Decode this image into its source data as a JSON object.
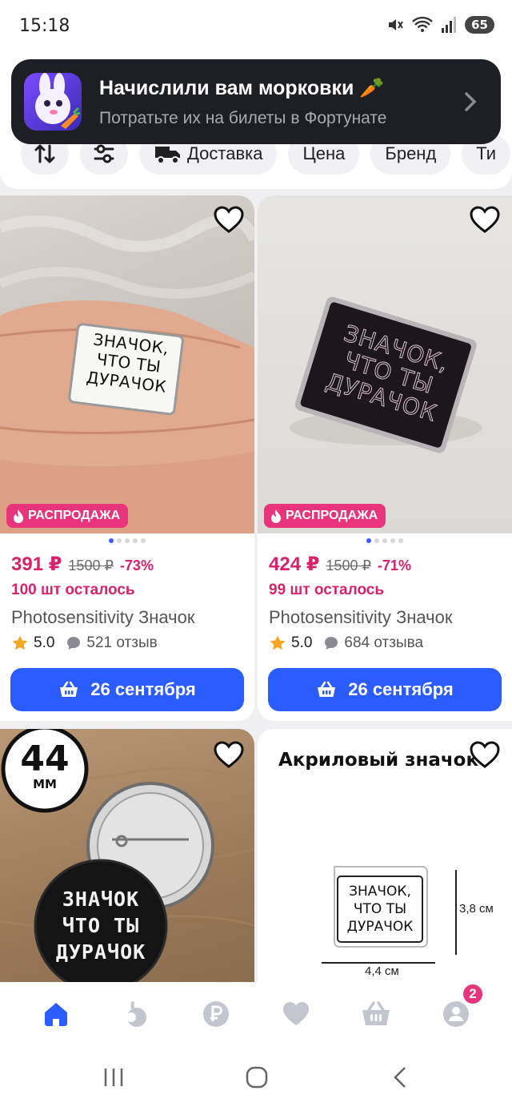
{
  "status_bar": {
    "time": "15:18",
    "battery": "65",
    "icons": [
      "mute-icon",
      "wifi-icon",
      "signal-icon",
      "battery-icon"
    ]
  },
  "toast": {
    "title": "Начислили вам морковки 🥕",
    "subtitle": "Потратьте их на билеты в Фортунате"
  },
  "filters": {
    "chips": [
      {
        "icon": "sort-icon",
        "label": ""
      },
      {
        "icon": "filter-sliders-icon",
        "label": ""
      },
      {
        "icon": "delivery-truck-icon",
        "label": "Доставка"
      },
      {
        "icon": "",
        "label": "Цена"
      },
      {
        "icon": "",
        "label": "Бренд"
      },
      {
        "icon": "",
        "label": "Ти"
      }
    ]
  },
  "products": [
    {
      "badge": "РАСПРОДАЖА",
      "price": "391 ₽",
      "old_price": "1500 ₽",
      "discount": "-73%",
      "left": "100 шт осталось",
      "name": "Photosensitivity Значок",
      "rating": "5.0",
      "reviews": "521 отзыв",
      "delivery": "26 сентября",
      "image_text": [
        "ЗНАЧОК,",
        "ЧТО ТЫ",
        "ДУРАЧОК"
      ]
    },
    {
      "badge": "РАСПРОДАЖА",
      "price": "424 ₽",
      "old_price": "1500 ₽",
      "discount": "-71%",
      "left": "99 шт осталось",
      "name": "Photosensitivity Значок",
      "rating": "5.0",
      "reviews": "684 отзыва",
      "delivery": "26 сентября",
      "image_text": [
        "ЗНАЧОК,",
        "ЧТО ТЫ",
        "ДУРАЧОК"
      ]
    },
    {
      "size_badge_num": "44",
      "size_badge_unit": "ММ",
      "image_text": [
        "ЗНАЧОК",
        "ЧТО ТЫ",
        "ДУРАЧОК"
      ]
    },
    {
      "image_title": "Акриловый значок",
      "image_text": [
        "ЗНАЧОК,",
        "ЧТО ТЫ",
        "ДУРАЧОК"
      ],
      "height_label": "3,8 см",
      "width_label": "4,4 см"
    }
  ],
  "bottom_nav": {
    "items": [
      "home-icon",
      "catalog-icon",
      "finance-icon",
      "favorites-icon",
      "cart-icon",
      "profile-icon"
    ],
    "profile_badge": "2",
    "active_color": "#2b5cff",
    "inactive_color": "#c4c6cf"
  }
}
